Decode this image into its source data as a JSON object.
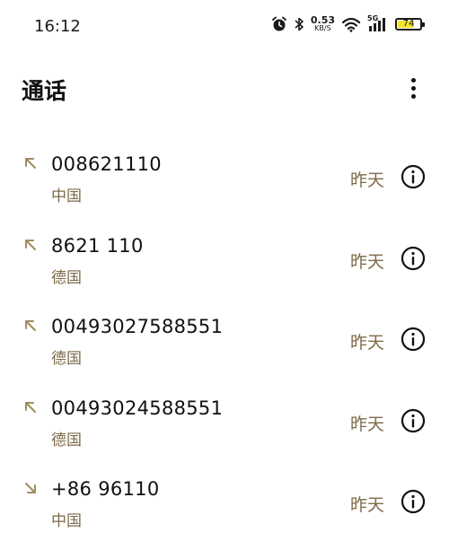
{
  "status_bar": {
    "time": "16:12",
    "net_speed_value": "0.53",
    "net_speed_unit": "KB/S",
    "network_type": "5G",
    "battery_level": "74",
    "icons": [
      "alarm-icon",
      "bluetooth-icon",
      "wifi-icon",
      "signal-icon",
      "battery-icon"
    ]
  },
  "header": {
    "title": "通话",
    "menu_icon": "more-vertical-icon"
  },
  "colors": {
    "accent_text": "#7d6a49",
    "direction_icon": "#a08c62",
    "battery_fill": "#f2e42a"
  },
  "calls": [
    {
      "number": "008621110",
      "location": "中国",
      "time": "昨天",
      "direction": "outgoing"
    },
    {
      "number": "8621 110",
      "location": "德国",
      "time": "昨天",
      "direction": "outgoing"
    },
    {
      "number": "00493027588551",
      "location": "德国",
      "time": "昨天",
      "direction": "outgoing"
    },
    {
      "number": "00493024588551",
      "location": "德国",
      "time": "昨天",
      "direction": "outgoing"
    },
    {
      "number": "+86 96110",
      "location": "中国",
      "time": "昨天",
      "direction": "incoming"
    }
  ]
}
